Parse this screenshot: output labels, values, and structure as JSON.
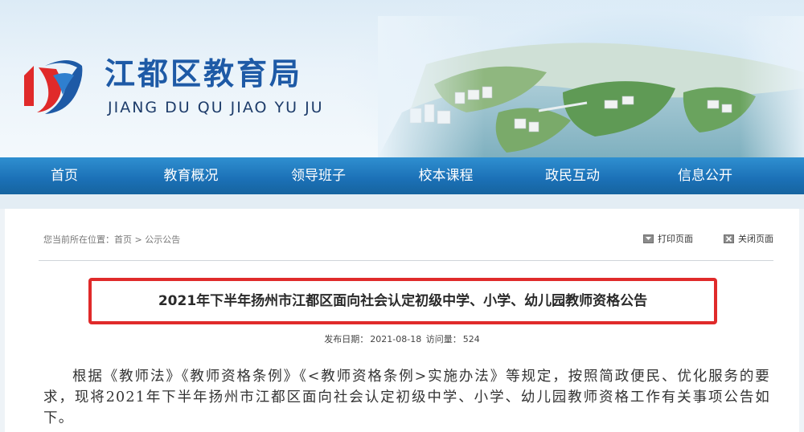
{
  "site": {
    "title": "江都区教育局",
    "subtitle": "JIANG DU QU JIAO YU JU"
  },
  "nav": {
    "items": [
      "首页",
      "教育概况",
      "领导班子",
      "校本课程",
      "政民互动",
      "信息公开"
    ]
  },
  "breadcrumb": {
    "prefix": "您当前所在位置：",
    "home": "首页",
    "separator": " > ",
    "current": "公示公告"
  },
  "tools": {
    "print": "打印页面",
    "close": "关闭页面"
  },
  "article": {
    "title": "2021年下半年扬州市江都区面向社会认定初级中学、小学、幼儿园教师资格公告",
    "date_label": "发布日期：",
    "date": "2021-08-18",
    "views_label": "访问量：",
    "views": "524",
    "paragraph": "根据《教师法》《教师资格条例》《<教师资格条例>实施办法》等规定，按照简政便民、优化服务的要求，现将2021年下半年扬州市江都区面向社会认定初级中学、小学、幼儿园教师资格工作有关事项公告如下。"
  },
  "colors": {
    "brand_blue": "#1e5aa6",
    "nav_blue": "#1b70b6",
    "highlight_red": "#e02a2a"
  }
}
